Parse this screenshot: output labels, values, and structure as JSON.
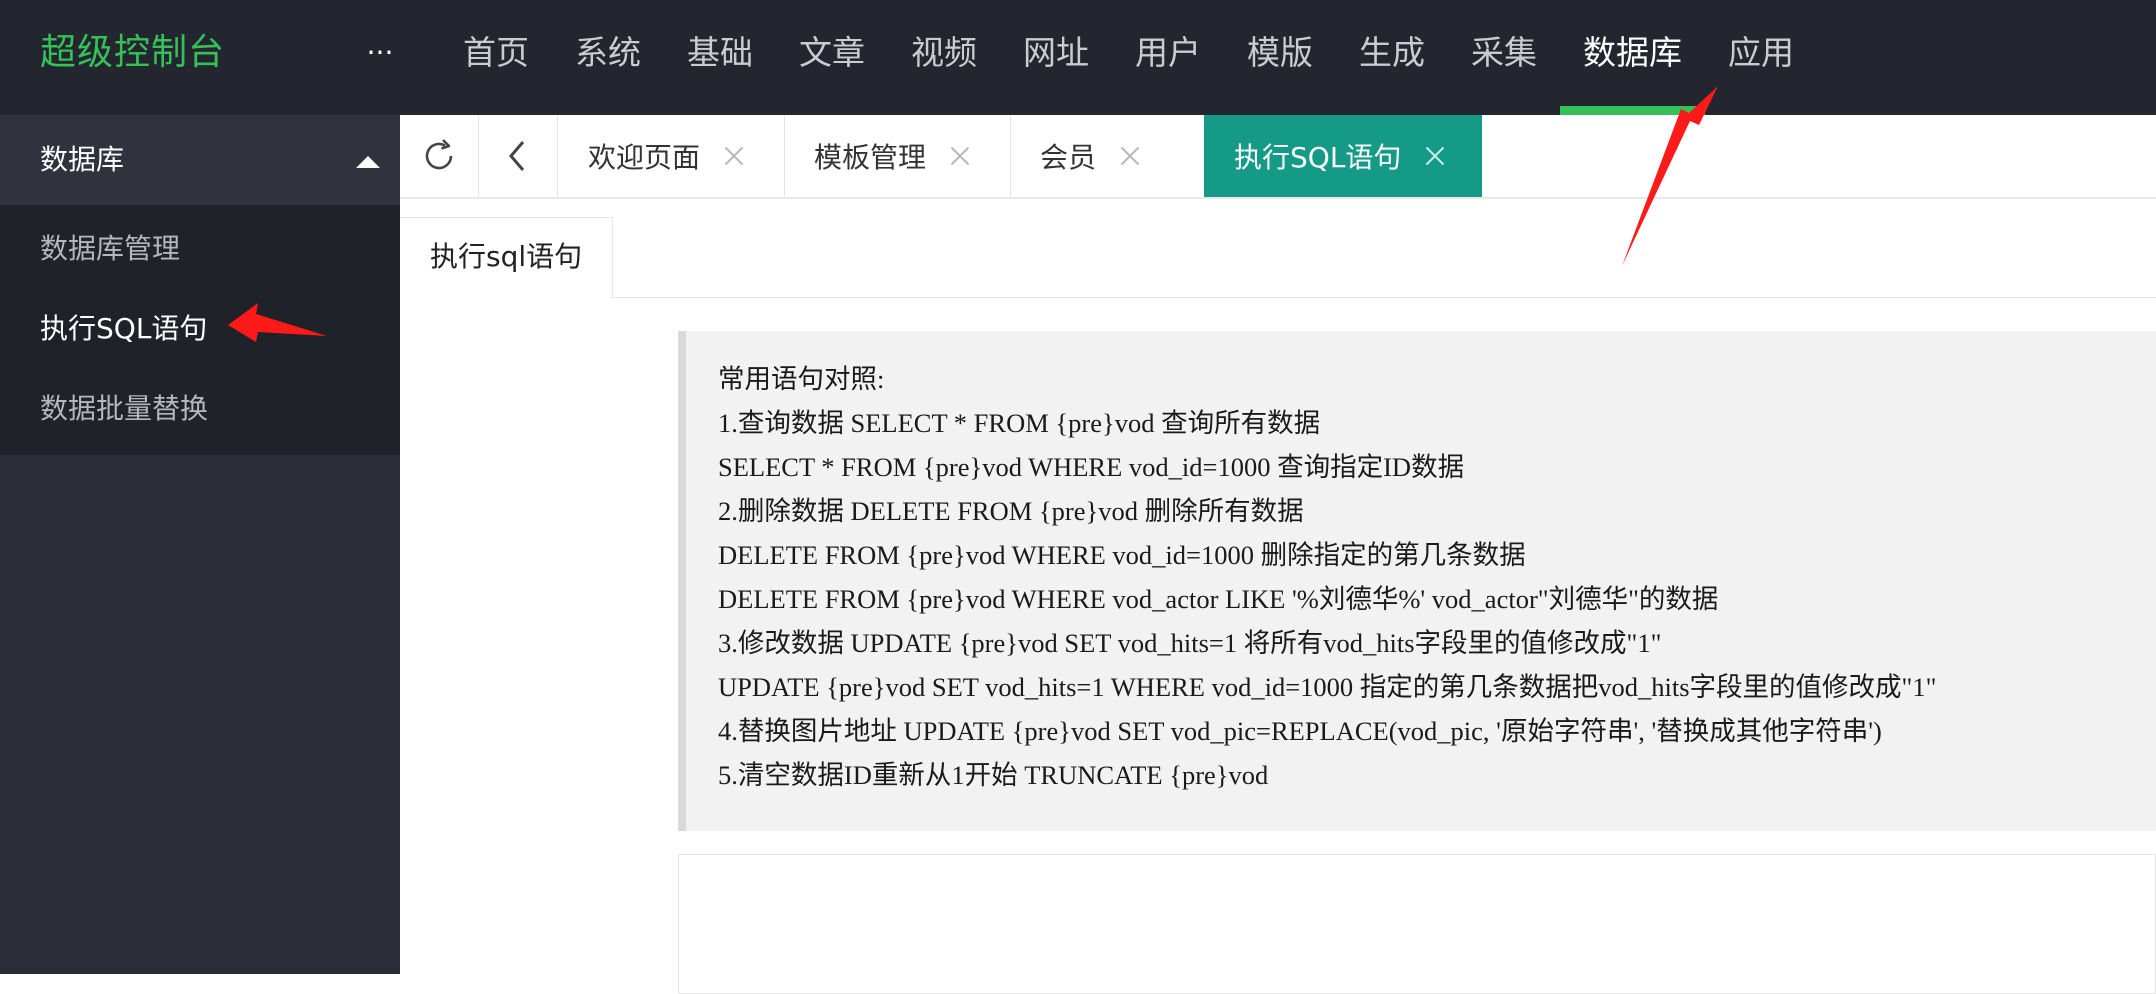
{
  "app": {
    "logo": "超级控制台",
    "more_label": "···"
  },
  "top_nav": {
    "items": [
      "首页",
      "系统",
      "基础",
      "文章",
      "视频",
      "网址",
      "用户",
      "模版",
      "生成",
      "采集",
      "数据库",
      "应用"
    ],
    "active": "数据库"
  },
  "sidebar": {
    "group_title": "数据库",
    "items": [
      "数据库管理",
      "执行SQL语句",
      "数据批量替换"
    ],
    "active": "执行SQL语句"
  },
  "tabs": {
    "refresh_icon": "refresh-icon",
    "back_icon": "chevron-left-icon",
    "items": [
      {
        "label": "欢迎页面",
        "active": false
      },
      {
        "label": "模板管理",
        "active": false
      },
      {
        "label": "会员",
        "active": false
      },
      {
        "label": "执行SQL语句",
        "active": true
      }
    ]
  },
  "content": {
    "subtab": "执行sql语句",
    "reference": {
      "title": "常用语句对照:",
      "lines": [
        "1.查询数据 SELECT * FROM {pre}vod 查询所有数据",
        "SELECT * FROM {pre}vod WHERE vod_id=1000 查询指定ID数据",
        "2.删除数据 DELETE FROM {pre}vod 删除所有数据",
        "DELETE FROM {pre}vod WHERE vod_id=1000 删除指定的第几条数据",
        "DELETE FROM {pre}vod WHERE vod_actor LIKE '%刘德华%' vod_actor\"刘德华\"的数据",
        "3.修改数据 UPDATE {pre}vod SET vod_hits=1 将所有vod_hits字段里的值修改成\"1\"",
        "UPDATE {pre}vod SET vod_hits=1 WHERE vod_id=1000 指定的第几条数据把vod_hits字段里的值修改成\"1\"",
        "4.替换图片地址 UPDATE {pre}vod SET vod_pic=REPLACE(vod_pic, '原始字符串', '替换成其他字符串')",
        "5.清空数据ID重新从1开始 TRUNCATE {pre}vod"
      ]
    },
    "sql_input": ""
  },
  "colors": {
    "topbar_bg": "#23262e",
    "logo": "#36c05a",
    "active_tab": "#159a88",
    "sidebar_bg": "#2a2d37",
    "annotation_arrow": "#ff1a1a"
  }
}
